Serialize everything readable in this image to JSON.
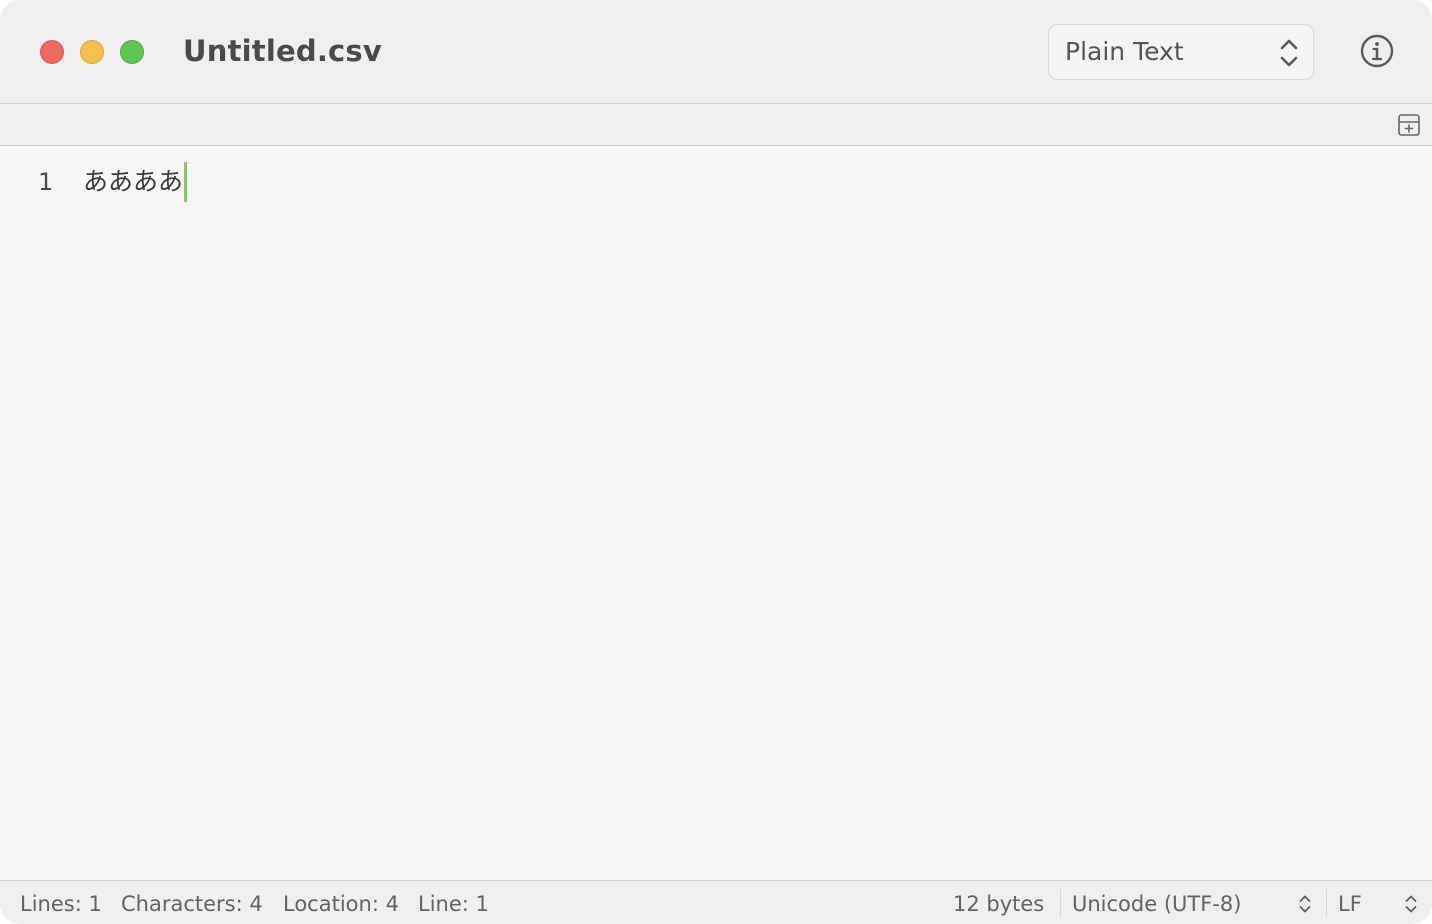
{
  "window": {
    "title": "Untitled.csv",
    "traffic_lights": {
      "close_color": "#ed6a5e",
      "minimize_color": "#f5bf4f",
      "zoom_color": "#61c554"
    }
  },
  "toolbar": {
    "syntax_mode": "Plain Text",
    "syntax_chevron_icon": "up-down-chevron-icon",
    "info_icon": "info-circle-icon",
    "split_icon": "split-editor-icon"
  },
  "editor": {
    "lines": [
      {
        "number": "1",
        "text": "ああああ"
      }
    ],
    "caret_color": "#8dc46a"
  },
  "statusbar": {
    "lines": "Lines: 1",
    "characters": "Characters: 4",
    "location": "Location: 4",
    "line": "Line: 1",
    "file_size": "12 bytes",
    "encoding": "Unicode (UTF-8)",
    "line_ending": "LF"
  }
}
